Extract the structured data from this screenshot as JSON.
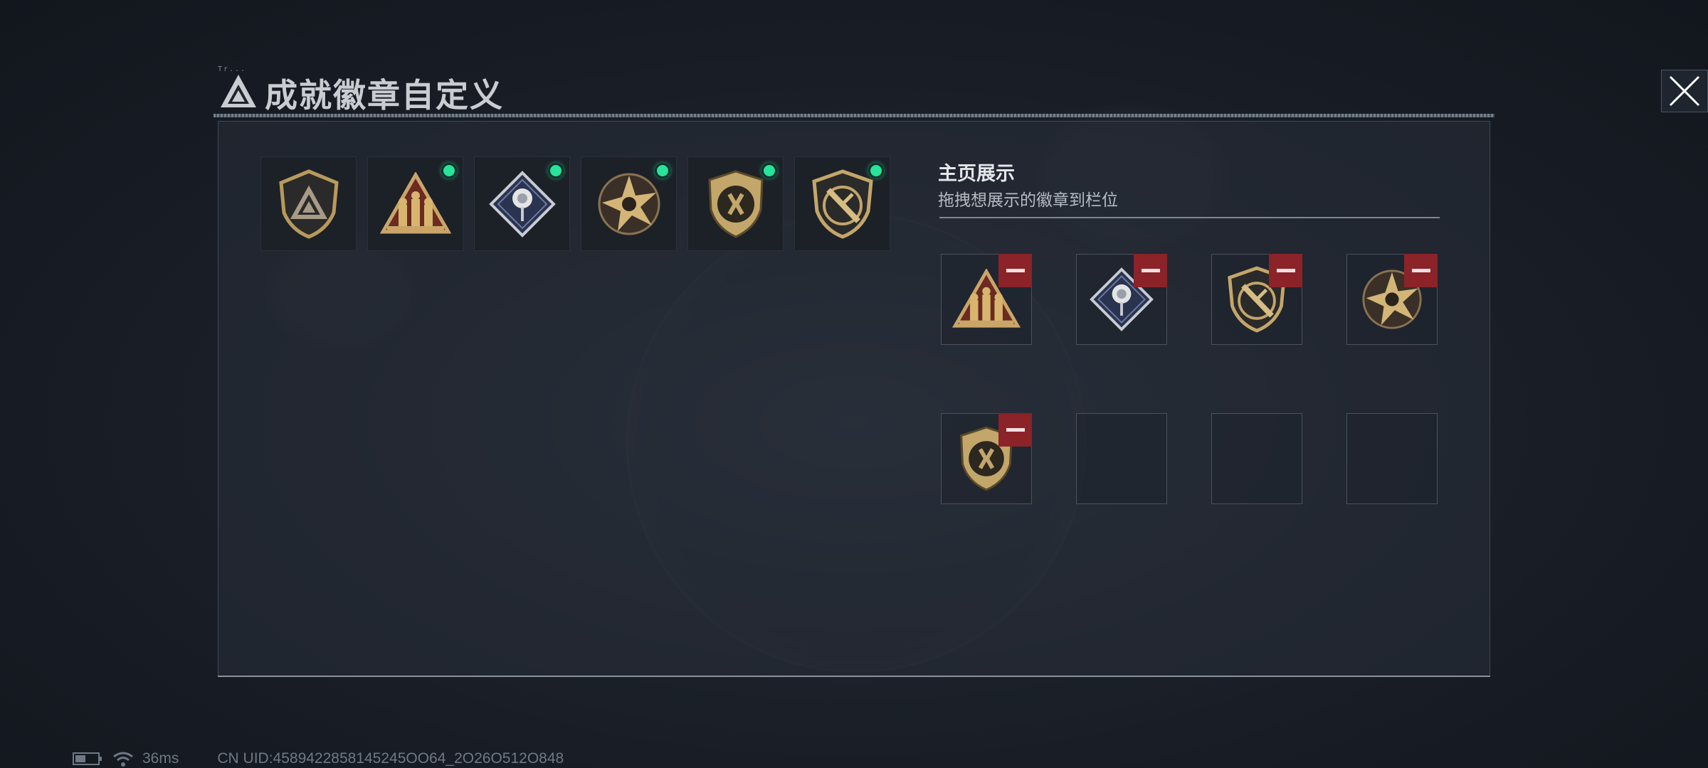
{
  "header": {
    "title": "成就徽章自定义",
    "small_tag": "Tr..."
  },
  "owned_badges": [
    {
      "icon": "triangle-shield-badge-icon",
      "new": false
    },
    {
      "icon": "soldiers-triangle-badge-icon",
      "new": true
    },
    {
      "icon": "rose-diamond-badge-icon",
      "new": true
    },
    {
      "icon": "star-skull-badge-icon",
      "new": true
    },
    {
      "icon": "chevron-shield-badge-icon",
      "new": true
    },
    {
      "icon": "dagger-shield-badge-icon",
      "new": true
    }
  ],
  "display": {
    "title": "主页展示",
    "subtitle": "拖拽想展示的徽章到栏位",
    "slots": [
      {
        "badge": "soldiers-triangle-badge-icon"
      },
      {
        "badge": "rose-diamond-badge-icon"
      },
      {
        "badge": "dagger-shield-badge-icon"
      },
      {
        "badge": "star-skull-badge-icon"
      },
      {
        "badge": "chevron-shield-badge-icon"
      },
      {
        "badge": null
      },
      {
        "badge": null
      },
      {
        "badge": null
      }
    ]
  },
  "status": {
    "ping": "36ms",
    "uid": "CN UID:4589422858145245OO64_2O26O512O848"
  },
  "colors": {
    "new_dot": "#28e39a",
    "remove": "#8b2329",
    "gold": "#b89a5c"
  }
}
